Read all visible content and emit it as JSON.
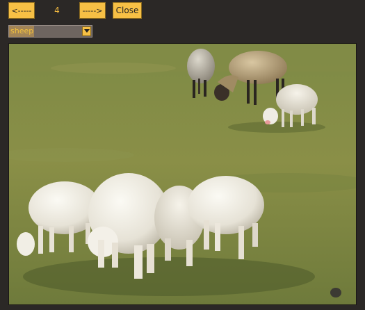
{
  "nav": {
    "prev_label": "<-----",
    "page_number": "4",
    "next_label": "----->",
    "close_label": "Close"
  },
  "category_select": {
    "selected": "sheep"
  },
  "photo": {
    "subject": "sheep-photo"
  },
  "colors": {
    "button_bg": "#f7c045",
    "page_bg": "#2b2826",
    "accent_text": "#f2b940",
    "select_bg": "#6e6560"
  }
}
